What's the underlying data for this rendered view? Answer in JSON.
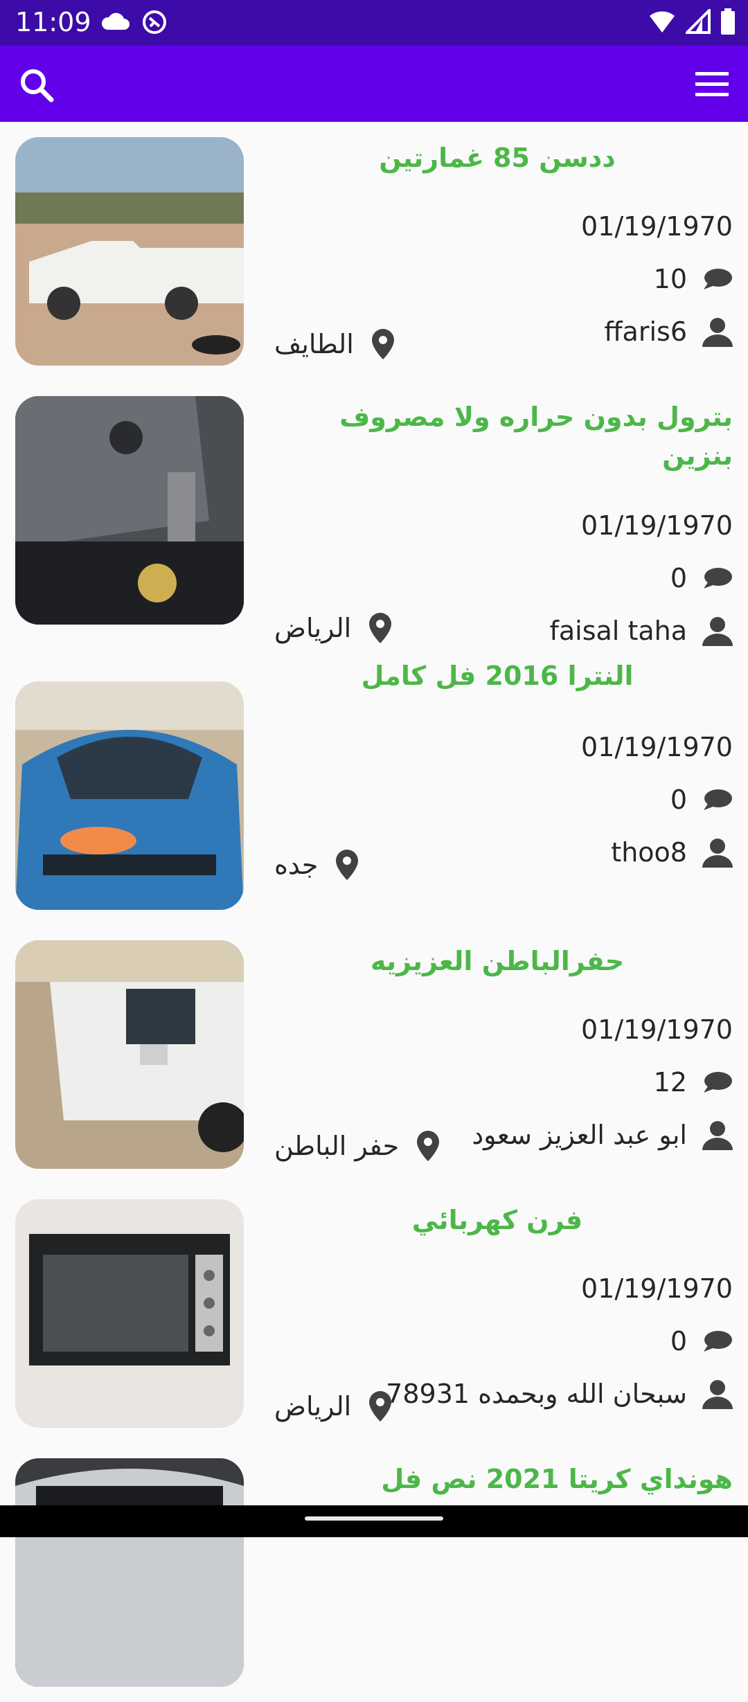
{
  "status_bar": {
    "time": "11:09"
  },
  "listings": [
    {
      "title": "ددسن 85 غمارتين",
      "date": "01/19/1970",
      "comments": "10",
      "user": "ffaris6",
      "location": "الطايف"
    },
    {
      "title": "بترول بدون حراره ولا مصروف بنزين",
      "date": "01/19/1970",
      "comments": "0",
      "user": "faisal taha",
      "location": "الرياض"
    },
    {
      "title": "النترا 2016 فل كامل",
      "date": "01/19/1970",
      "comments": "0",
      "user": "thoo8",
      "location": "جده"
    },
    {
      "title": "حفرالباطن العزيزيه",
      "date": "01/19/1970",
      "comments": "12",
      "user": "ابو عبد العزيز سعود",
      "location": "حفر الباطن"
    },
    {
      "title": "فرن كهربائي",
      "date": "01/19/1970",
      "comments": "0",
      "user": "سبحان الله وبحمده 78931",
      "location": "الرياض"
    },
    {
      "title": "هونداي كريتا 2021 نص فل"
    }
  ],
  "colors": {
    "status_bar": "#3d0ba8",
    "app_bar": "#6200ea",
    "title_green": "#4cb748"
  }
}
